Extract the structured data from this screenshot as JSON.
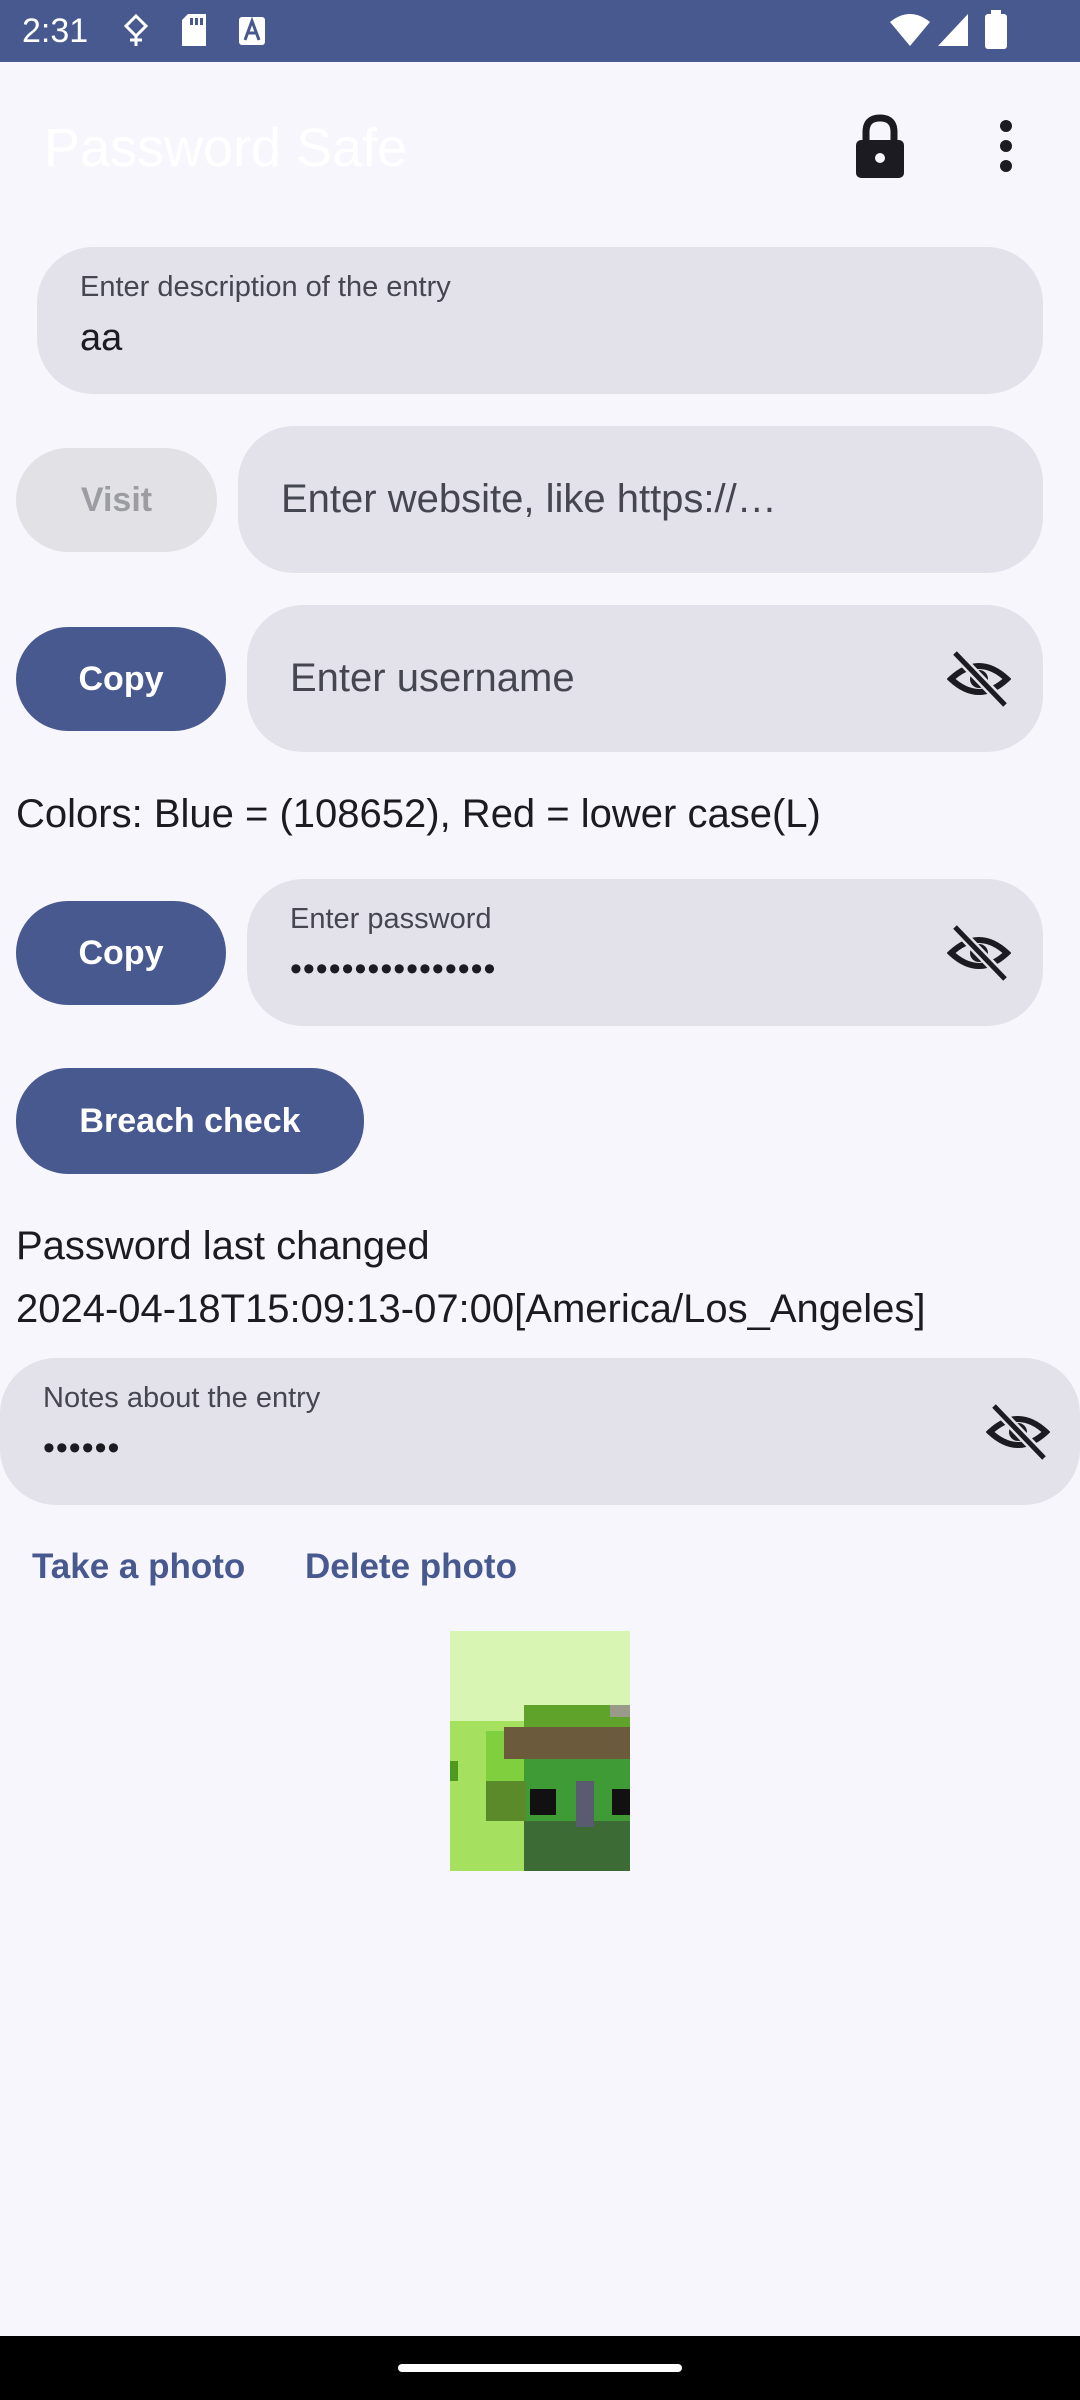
{
  "status_bar": {
    "time": "2:31",
    "left_icons": [
      "usb-debug-icon",
      "sd-card-icon",
      "a-badge-icon"
    ],
    "right_icons": [
      "wifi-icon",
      "signal-icon",
      "battery-icon"
    ],
    "background": "#47598f"
  },
  "app_bar": {
    "title": "Password Safe",
    "actions": [
      "lock-icon",
      "more-vert-icon"
    ]
  },
  "form": {
    "description": {
      "label": "Enter description of the entry",
      "value": "aa"
    },
    "website": {
      "visit_label": "Visit",
      "placeholder": "Enter website, like https://…"
    },
    "username": {
      "copy_label": "Copy",
      "placeholder": "Enter username",
      "visibility_icon": "visibility-off-icon"
    },
    "colors_hint": "Colors: Blue = (108652), Red = lower case(L)",
    "password": {
      "copy_label": "Copy",
      "label": "Enter password",
      "masked_value": "••••••••••••••••",
      "visibility_icon": "visibility-off-icon"
    },
    "breach_check_label": "Breach check",
    "last_changed_label": "Password last changed",
    "last_changed_value": "2024-04-18T15:09:13-07:00[America/Los_Angeles]",
    "notes": {
      "label": "Notes about the entry",
      "masked_value": "••••••",
      "visibility_icon": "visibility-off-icon"
    }
  },
  "photo": {
    "take_label": "Take a photo",
    "delete_label": "Delete photo"
  },
  "colors": {
    "accent": "#47598f",
    "field_bg": "#e3e2ea",
    "page_bg": "#f7f6fd"
  }
}
